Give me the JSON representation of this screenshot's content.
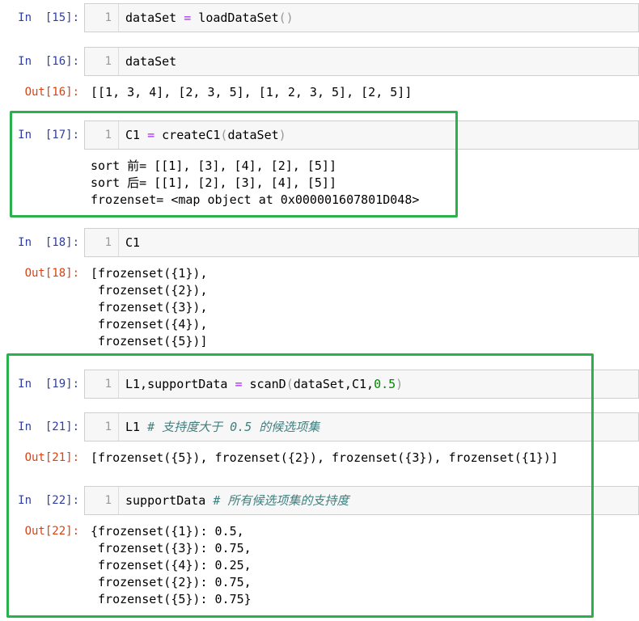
{
  "cells": {
    "c15": {
      "prompt": "In  [15]:",
      "line": "1",
      "code": {
        "a": "dataSet ",
        "b": "=",
        "c": " loadDataSet",
        "d": "()"
      }
    },
    "c16": {
      "prompt": "In  [16]:",
      "line": "1",
      "code": "dataSet",
      "out_prompt": "Out[16]:",
      "output": "[[1, 3, 4], [2, 3, 5], [1, 2, 3, 5], [2, 5]]"
    },
    "c17": {
      "prompt": "In  [17]:",
      "line": "1",
      "code": {
        "a": "C1 ",
        "b": "=",
        "c": " createC1",
        "d": "(",
        "e": "dataSet",
        "f": ")"
      },
      "output": "sort 前= [[1], [3], [4], [2], [5]]\nsort 后= [[1], [2], [3], [4], [5]]\nfrozenset= <map object at 0x000001607801D048>"
    },
    "c18": {
      "prompt": "In  [18]:",
      "line": "1",
      "code": "C1",
      "out_prompt": "Out[18]:",
      "output": "[frozenset({1}),\n frozenset({2}),\n frozenset({3}),\n frozenset({4}),\n frozenset({5})]"
    },
    "c19": {
      "prompt": "In  [19]:",
      "line": "1",
      "code": {
        "a": "L1,supportData ",
        "b": "=",
        "c": " scanD",
        "d": "(",
        "e": "dataSet,C1,",
        "f": "0.5",
        "g": ")"
      }
    },
    "c21": {
      "prompt": "In  [21]:",
      "line": "1",
      "code": {
        "a": "L1 ",
        "comment": "# 支持度大于 0.5 的候选项集"
      },
      "out_prompt": "Out[21]:",
      "output": "[frozenset({5}), frozenset({2}), frozenset({3}), frozenset({1})]"
    },
    "c22": {
      "prompt": "In  [22]:",
      "line": "1",
      "code": {
        "a": "supportData ",
        "comment": "# 所有候选项集的支持度"
      },
      "out_prompt": "Out[22]:",
      "output": "{frozenset({1}): 0.5,\n frozenset({3}): 0.75,\n frozenset({4}): 0.25,\n frozenset({2}): 0.75,\n frozenset({5}): 0.75}"
    }
  },
  "colors": {
    "highlight": "#2bb14c",
    "in_prompt": "#303f9f",
    "out_prompt": "#d84315"
  }
}
